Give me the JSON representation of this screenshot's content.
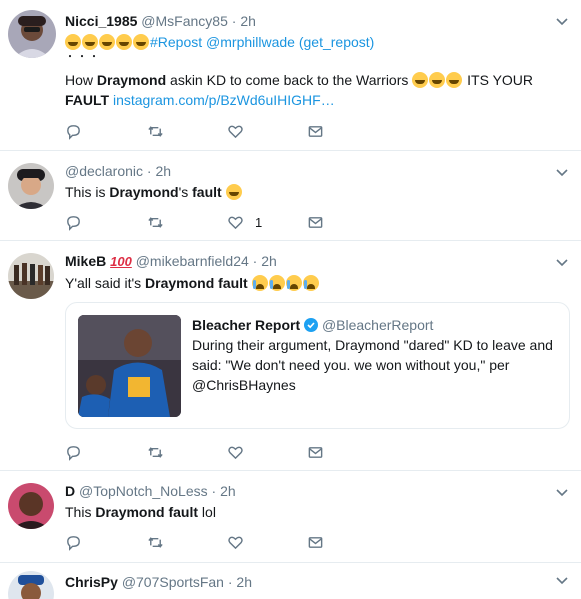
{
  "tweets": [
    {
      "name": "Nicci_1985",
      "handle": "@MsFancy85",
      "time": "2h",
      "line1_text": "#Repost @mrphillwade (get_repost)",
      "line2": "・・・",
      "line3_pre": "How ",
      "line3_bold": "Draymond",
      "line3_mid": " askin KD to come back to the Warriors ",
      "line3_post": " ITS YOUR",
      "line4_bold": "FAULT",
      "line4_link": "instagram.com/p/BzWd6uIHIGHF…"
    },
    {
      "name": "",
      "handle": "@declaronic",
      "time": "2h",
      "text_pre": "This is ",
      "text_bold1": "Draymond",
      "text_mid": "'s ",
      "text_bold2": "fault",
      "like_count": "1"
    },
    {
      "name": "MikeB",
      "handle": "@mikebarnfield24",
      "time": "2h",
      "text_pre": "Y'all said it's ",
      "text_bold": "Draymond fault",
      "card": {
        "name": "Bleacher Report",
        "handle": "@BleacherReport",
        "line1": "During their argument, Draymond \"dared\" KD to leave and",
        "line2": "said: \"We don't need you. we won without you,\" per",
        "line3": "@ChrisBHaynes"
      }
    },
    {
      "name": "D",
      "handle": "@TopNotch_NoLess",
      "time": "2h",
      "text_pre": "This ",
      "text_bold": "Draymond fault",
      "text_post": " lol"
    },
    {
      "name": "ChrisPy",
      "handle": "@707SportsFan",
      "time": "2h"
    }
  ],
  "dot": "·",
  "colors": {
    "accent": "#1b95e0",
    "muted": "#657786",
    "border": "#e6ecf0"
  },
  "icons": [
    "reply-icon",
    "retweet-icon",
    "like-icon",
    "message-icon",
    "chevron-down-icon",
    "verified-icon"
  ]
}
